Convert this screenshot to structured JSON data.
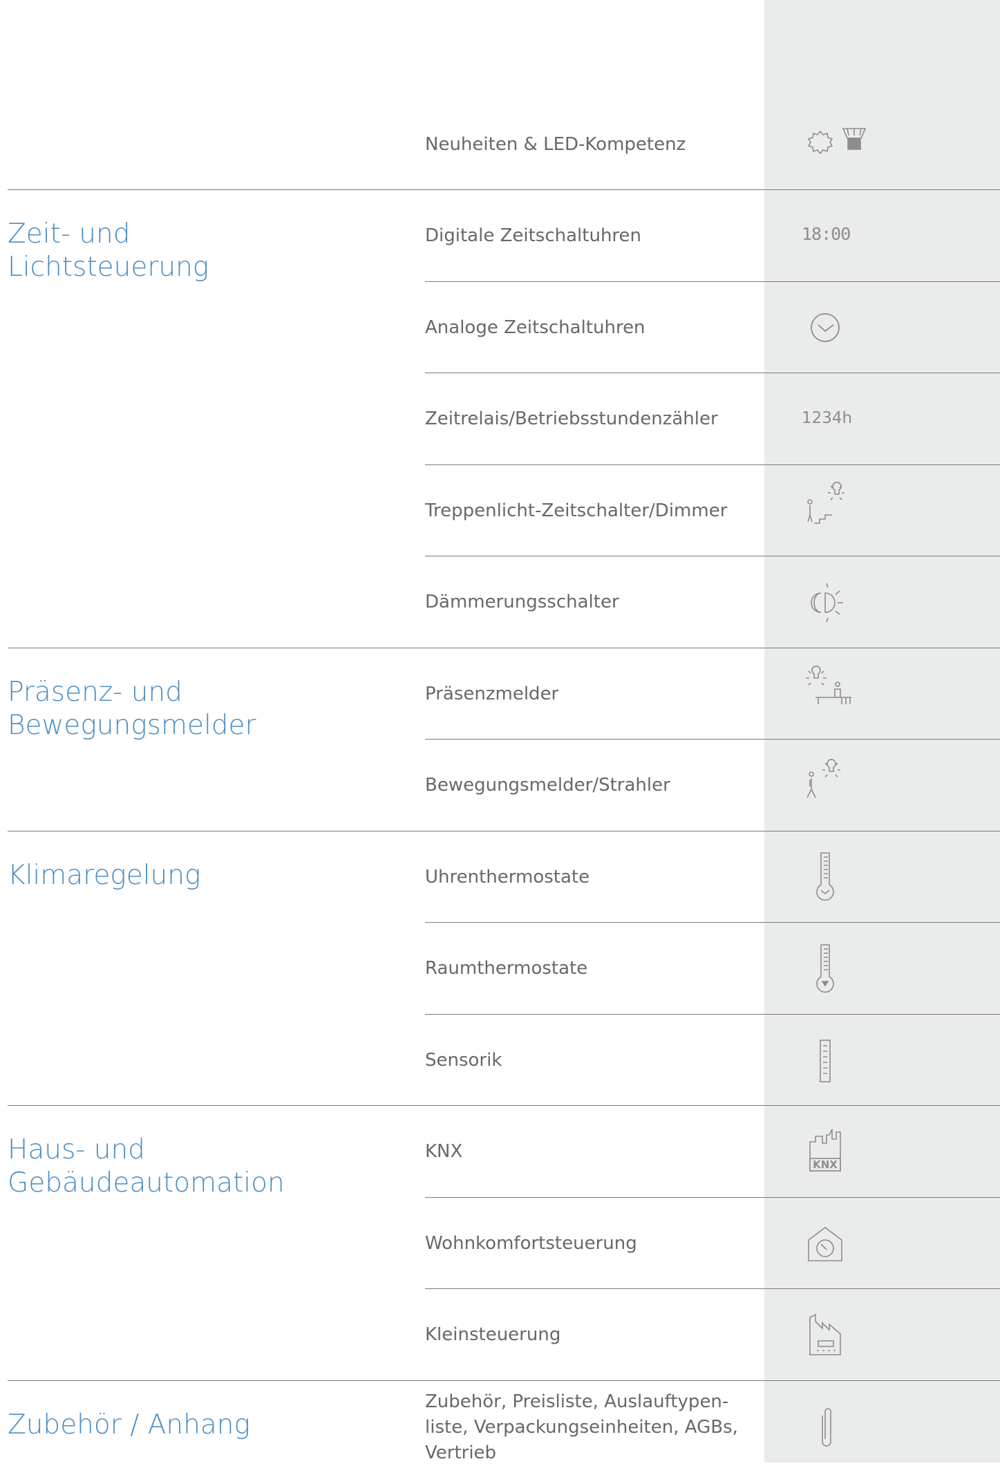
{
  "categories": {
    "zeit": "Zeit- und\nLichtsteuerung",
    "praesenz": "Präsenz- und\nBewegungsmelder",
    "klima": "Klimaregelung",
    "haus": "Haus- und\nGebäudeautomation",
    "zubehoer": "Zubehör / Anhang"
  },
  "items": [
    {
      "label": "Neuheiten & LED-Kompetenz",
      "icon": "led-bulb-icon"
    },
    {
      "label": "Digitale Zeitschaltuhren",
      "icon": "digital-clock-icon",
      "icon_text": "18:00"
    },
    {
      "label": "Analoge Zeitschaltuhren",
      "icon": "analog-clock-icon"
    },
    {
      "label": "Zeitrelais/Betriebsstundenzähler",
      "icon": "hour-counter-icon",
      "icon_text": "1234h"
    },
    {
      "label": "Treppenlicht-Zeitschalter/Dimmer",
      "icon": "staircase-light-icon"
    },
    {
      "label": "Dämmerungsschalter",
      "icon": "twilight-switch-icon"
    },
    {
      "label": "Präsenzmelder",
      "icon": "presence-detector-icon"
    },
    {
      "label": "Bewegungsmelder/Strahler",
      "icon": "motion-detector-icon"
    },
    {
      "label": "Uhrenthermostate",
      "icon": "clock-thermostat-icon"
    },
    {
      "label": "Raumthermostate",
      "icon": "room-thermostat-icon"
    },
    {
      "label": "Sensorik",
      "icon": "sensor-icon"
    },
    {
      "label": "KNX",
      "icon": "knx-building-icon",
      "icon_text": "KNX"
    },
    {
      "label": "Wohnkomfortsteuerung",
      "icon": "home-control-icon"
    },
    {
      "label": "Kleinsteuerung",
      "icon": "factory-icon"
    },
    {
      "label": "Zubehör, Preisliste, Auslauftypen-\nliste, Verpackungseinheiten, AGBs,\nVertrieb",
      "icon": "paperclip-icon"
    }
  ],
  "colors": {
    "category": "#4a8dc3",
    "item": "#686868",
    "icon_column": "#eaebeb",
    "rule": "#7a7a7a"
  }
}
